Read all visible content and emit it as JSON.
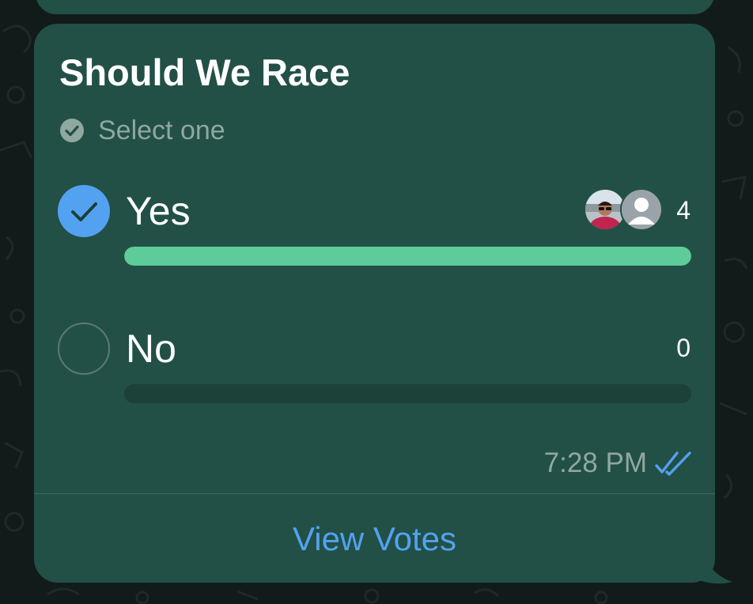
{
  "poll": {
    "title": "Should We Race",
    "select_hint": "Select one",
    "options": [
      {
        "label": "Yes",
        "votes": "4",
        "selected": true,
        "vote_fraction": 1.0
      },
      {
        "label": "No",
        "votes": "0",
        "selected": false,
        "vote_fraction": 0.0
      }
    ],
    "timestamp": "7:28 PM",
    "read_status": "double-check-read-icon",
    "view_votes_label": "View Votes"
  },
  "icons": {
    "select_hint": "check-circle-icon",
    "selected_radio": "checkmark-icon",
    "voter_1": "avatar-photo",
    "voter_2": "default-avatar-icon"
  },
  "colors": {
    "bubble": "#225046",
    "accent_blue": "#53a2f1",
    "bar_fill": "#5dcc9a",
    "bar_track": "#1c4139",
    "muted_text": "#8fa8a0",
    "title_text": "#ffffff"
  }
}
